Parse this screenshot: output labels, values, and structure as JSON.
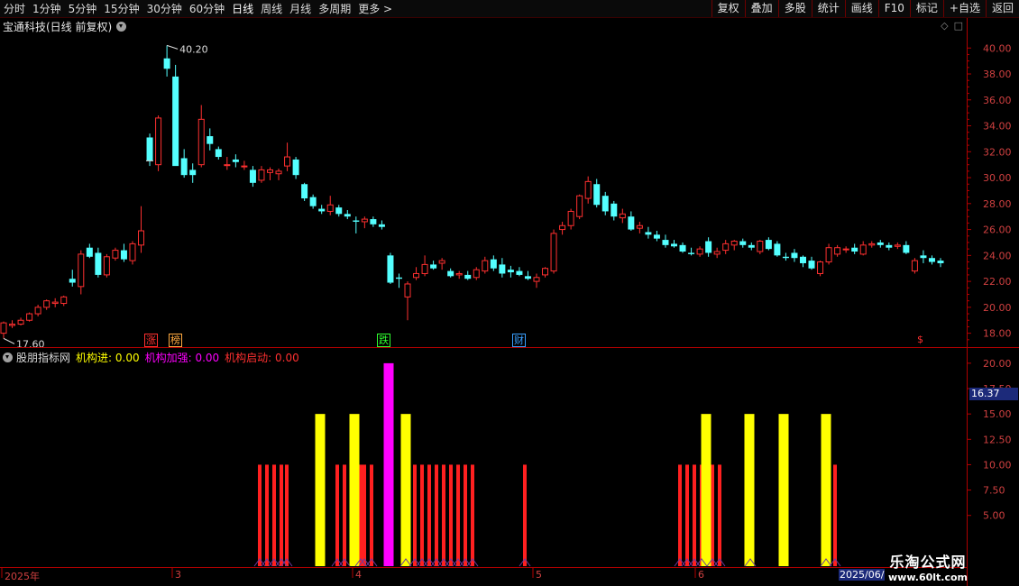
{
  "toolbar": {
    "periods": [
      "分时",
      "1分钟",
      "5分钟",
      "15分钟",
      "30分钟",
      "60分钟",
      "日线",
      "周线",
      "月线",
      "多周期",
      "更多 >"
    ],
    "active_period": "日线",
    "actions": [
      "复权",
      "叠加",
      "多股",
      "统计",
      "画线",
      "F10",
      "标记",
      "+自选",
      "返回"
    ]
  },
  "stock": {
    "title": "宝通科技(日线 前复权)",
    "high_label": "40.20",
    "low_label": "17.60"
  },
  "price_axis": {
    "ticks": [
      "40.00",
      "38.00",
      "36.00",
      "34.00",
      "32.00",
      "30.00",
      "28.00",
      "26.00",
      "24.00",
      "22.00",
      "20.00",
      "18.00"
    ]
  },
  "event_tags": [
    {
      "text": "涨",
      "color": "#ff3030"
    },
    {
      "text": "榜",
      "color": "#ffaa40"
    },
    {
      "text": "跌",
      "color": "#30ff30"
    },
    {
      "text": "财",
      "color": "#3aa0ff"
    },
    {
      "text": "$",
      "color": "#ff3030"
    }
  ],
  "indicator": {
    "name": "股朋指标网",
    "items": [
      {
        "label": "机构进: 0.00",
        "color": "#ffff00"
      },
      {
        "label": "机构加强: 0.00",
        "color": "#ff00ff"
      },
      {
        "label": "机构启动: 0.00",
        "color": "#ff3030"
      }
    ],
    "current_value": "16.37",
    "ticks": [
      "20.00",
      "17.50",
      "15.00",
      "12.50",
      "10.00",
      "7.50",
      "5.00"
    ]
  },
  "date_axis": {
    "labels": [
      "2025年",
      "3",
      "4",
      "5",
      "6"
    ],
    "end_label": "2025/06/"
  },
  "watermark": {
    "title": "乐淘公式网",
    "url": "www.60lt.com"
  },
  "colors": {
    "up": "#ff3030",
    "down": "#54ffff",
    "axis": "#b00000",
    "yellow": "#ffff00",
    "magenta": "#ff00ff"
  },
  "chart_data": [
    {
      "type": "candlestick",
      "title": "宝通科技(日线 前复权)",
      "ylim": [
        17,
        41.2
      ],
      "candles": [
        [
          18.0,
          18.9,
          17.6,
          18.8
        ],
        [
          18.6,
          19.0,
          18.4,
          18.7
        ],
        [
          18.7,
          19.2,
          18.6,
          19.0
        ],
        [
          19.0,
          19.6,
          18.9,
          19.5
        ],
        [
          19.5,
          20.2,
          19.3,
          20.0
        ],
        [
          20.0,
          20.6,
          19.8,
          20.5
        ],
        [
          20.3,
          20.7,
          20.0,
          20.4
        ],
        [
          20.3,
          20.9,
          20.1,
          20.8
        ],
        [
          22.2,
          22.9,
          21.6,
          21.9
        ],
        [
          21.6,
          24.4,
          21.0,
          24.1
        ],
        [
          24.6,
          24.9,
          23.8,
          23.9
        ],
        [
          24.2,
          24.6,
          22.3,
          22.5
        ],
        [
          22.5,
          24.1,
          22.3,
          23.9
        ],
        [
          23.8,
          24.6,
          23.6,
          24.4
        ],
        [
          24.4,
          24.9,
          23.5,
          23.7
        ],
        [
          23.6,
          25.1,
          23.3,
          24.9
        ],
        [
          24.8,
          27.8,
          24.2,
          25.9
        ],
        [
          33.1,
          33.4,
          30.9,
          31.3
        ],
        [
          31.0,
          34.8,
          30.5,
          34.6
        ],
        [
          39.2,
          40.2,
          37.8,
          38.4
        ],
        [
          37.8,
          38.7,
          33.6,
          30.9
        ],
        [
          31.5,
          32.2,
          30.0,
          30.2
        ],
        [
          30.6,
          31.1,
          29.6,
          30.2
        ],
        [
          31.0,
          35.6,
          30.8,
          34.5
        ],
        [
          33.2,
          33.8,
          32.1,
          32.6
        ],
        [
          32.2,
          32.4,
          31.4,
          31.6
        ],
        [
          31.0,
          31.6,
          30.6,
          31.0
        ],
        [
          31.4,
          31.8,
          30.8,
          31.2
        ],
        [
          30.9,
          31.3,
          30.6,
          30.9
        ],
        [
          30.6,
          30.9,
          29.3,
          29.6
        ],
        [
          29.8,
          30.9,
          29.6,
          30.6
        ],
        [
          30.4,
          30.8,
          29.8,
          30.6
        ],
        [
          30.3,
          30.7,
          29.8,
          30.5
        ],
        [
          30.9,
          32.7,
          30.5,
          31.6
        ],
        [
          31.4,
          31.6,
          29.9,
          30.2
        ],
        [
          29.5,
          29.6,
          28.2,
          28.4
        ],
        [
          28.5,
          28.7,
          27.6,
          27.8
        ],
        [
          27.6,
          27.9,
          27.2,
          27.4
        ],
        [
          27.4,
          28.6,
          27.1,
          27.9
        ],
        [
          27.7,
          27.9,
          27.0,
          27.2
        ],
        [
          27.2,
          27.5,
          26.8,
          27.0
        ],
        [
          26.7,
          27.0,
          25.7,
          26.6
        ],
        [
          26.6,
          27.0,
          26.1,
          26.8
        ],
        [
          26.8,
          27.0,
          26.2,
          26.4
        ],
        [
          26.4,
          26.7,
          26.0,
          26.2
        ],
        [
          24.0,
          24.2,
          21.8,
          21.9
        ],
        [
          22.3,
          22.6,
          21.5,
          22.2
        ],
        [
          20.8,
          22.0,
          19.0,
          21.8
        ],
        [
          22.3,
          23.1,
          22.1,
          22.6
        ],
        [
          22.6,
          24.0,
          22.4,
          23.3
        ],
        [
          23.3,
          23.6,
          22.9,
          23.0
        ],
        [
          23.4,
          23.8,
          22.9,
          23.6
        ],
        [
          22.8,
          23.0,
          22.3,
          22.4
        ],
        [
          22.5,
          22.8,
          22.2,
          22.6
        ],
        [
          22.5,
          22.8,
          22.1,
          22.2
        ],
        [
          22.3,
          23.1,
          22.1,
          22.9
        ],
        [
          22.8,
          23.9,
          22.6,
          23.6
        ],
        [
          23.7,
          24.0,
          22.8,
          23.0
        ],
        [
          23.3,
          23.8,
          22.3,
          22.6
        ],
        [
          22.9,
          23.2,
          22.3,
          22.7
        ],
        [
          22.8,
          23.1,
          22.4,
          22.5
        ],
        [
          22.4,
          22.8,
          22.1,
          22.2
        ],
        [
          22.0,
          22.6,
          21.5,
          22.3
        ],
        [
          22.5,
          23.1,
          22.3,
          23.0
        ],
        [
          22.8,
          26.0,
          22.6,
          25.7
        ],
        [
          26.0,
          26.6,
          25.6,
          26.3
        ],
        [
          26.3,
          27.6,
          26.0,
          27.4
        ],
        [
          27.0,
          28.7,
          26.8,
          28.6
        ],
        [
          28.4,
          30.1,
          28.0,
          29.7
        ],
        [
          29.5,
          29.9,
          27.7,
          27.9
        ],
        [
          28.6,
          28.9,
          27.1,
          27.4
        ],
        [
          28.0,
          28.2,
          26.7,
          27.0
        ],
        [
          26.9,
          27.6,
          26.5,
          27.2
        ],
        [
          27.0,
          27.4,
          25.9,
          26.0
        ],
        [
          26.1,
          26.6,
          25.7,
          26.3
        ],
        [
          25.8,
          26.2,
          25.3,
          25.6
        ],
        [
          25.6,
          25.9,
          25.1,
          25.3
        ],
        [
          25.2,
          25.6,
          24.6,
          24.8
        ],
        [
          24.9,
          25.2,
          24.6,
          24.7
        ],
        [
          24.8,
          25.0,
          24.2,
          24.3
        ],
        [
          24.2,
          24.6,
          24.0,
          24.1
        ],
        [
          24.1,
          24.7,
          23.9,
          24.5
        ],
        [
          25.1,
          25.4,
          23.9,
          24.2
        ],
        [
          24.1,
          24.6,
          23.8,
          24.3
        ],
        [
          24.4,
          25.2,
          24.1,
          24.9
        ],
        [
          24.8,
          25.2,
          24.4,
          25.1
        ],
        [
          25.1,
          25.3,
          24.6,
          24.8
        ],
        [
          24.8,
          25.0,
          24.4,
          24.6
        ],
        [
          24.3,
          25.2,
          24.1,
          25.1
        ],
        [
          25.2,
          25.4,
          24.4,
          24.5
        ],
        [
          24.9,
          25.1,
          23.9,
          24.0
        ],
        [
          23.9,
          24.2,
          23.6,
          23.8
        ],
        [
          24.2,
          24.5,
          23.5,
          23.8
        ],
        [
          23.9,
          24.0,
          23.1,
          23.4
        ],
        [
          23.6,
          23.9,
          22.9,
          23.0
        ],
        [
          22.6,
          23.6,
          22.4,
          23.5
        ],
        [
          23.5,
          24.9,
          23.3,
          24.6
        ],
        [
          24.1,
          24.8,
          23.9,
          24.6
        ],
        [
          24.5,
          24.7,
          24.2,
          24.5
        ],
        [
          24.6,
          24.9,
          24.1,
          24.3
        ],
        [
          24.1,
          25.1,
          24.0,
          24.8
        ],
        [
          24.8,
          25.1,
          24.6,
          24.9
        ],
        [
          25.0,
          25.2,
          24.6,
          24.8
        ],
        [
          24.8,
          25.0,
          24.4,
          24.6
        ],
        [
          24.7,
          25.0,
          24.5,
          24.8
        ],
        [
          24.8,
          25.1,
          24.1,
          24.2
        ],
        [
          22.8,
          23.8,
          22.6,
          23.6
        ],
        [
          24.0,
          24.4,
          23.4,
          23.8
        ],
        [
          23.8,
          24.0,
          23.3,
          23.5
        ],
        [
          23.6,
          23.8,
          23.1,
          23.4
        ]
      ]
    },
    {
      "type": "bar",
      "title": "股朋指标网",
      "ylim": [
        0,
        21.5
      ],
      "series": [
        {
          "name": "机构启动",
          "color": "#ff2020",
          "values": [
            [
              288,
              10
            ],
            [
              296,
              10
            ],
            [
              304,
              10
            ],
            [
              312,
              10
            ],
            [
              318,
              10
            ],
            [
              374,
              10
            ],
            [
              382,
              10
            ],
            [
              400,
              10
            ],
            [
              404,
              10
            ],
            [
              412,
              10
            ],
            [
              450,
              10
            ],
            [
              460,
              10
            ],
            [
              468,
              10
            ],
            [
              476,
              10
            ],
            [
              484,
              10
            ],
            [
              492,
              10
            ],
            [
              500,
              10
            ],
            [
              508,
              10
            ],
            [
              516,
              10
            ],
            [
              524,
              10
            ],
            [
              582,
              10
            ],
            [
              754,
              10
            ],
            [
              762,
              10
            ],
            [
              770,
              10
            ],
            [
              778,
              10
            ],
            [
              790,
              10
            ],
            [
              798,
              10
            ],
            [
              832,
              10
            ],
            [
              916,
              10
            ],
            [
              926,
              10
            ]
          ]
        },
        {
          "name": "机构进",
          "color": "#ffff00",
          "values": [
            [
              355,
              15
            ],
            [
              393,
              15
            ],
            [
              450,
              15
            ],
            [
              783,
              15
            ],
            [
              831,
              15
            ],
            [
              869,
              15
            ],
            [
              916,
              15
            ]
          ]
        },
        {
          "name": "机构加强",
          "color": "#ff00ff",
          "values": [
            [
              431,
              20
            ]
          ]
        }
      ]
    }
  ]
}
